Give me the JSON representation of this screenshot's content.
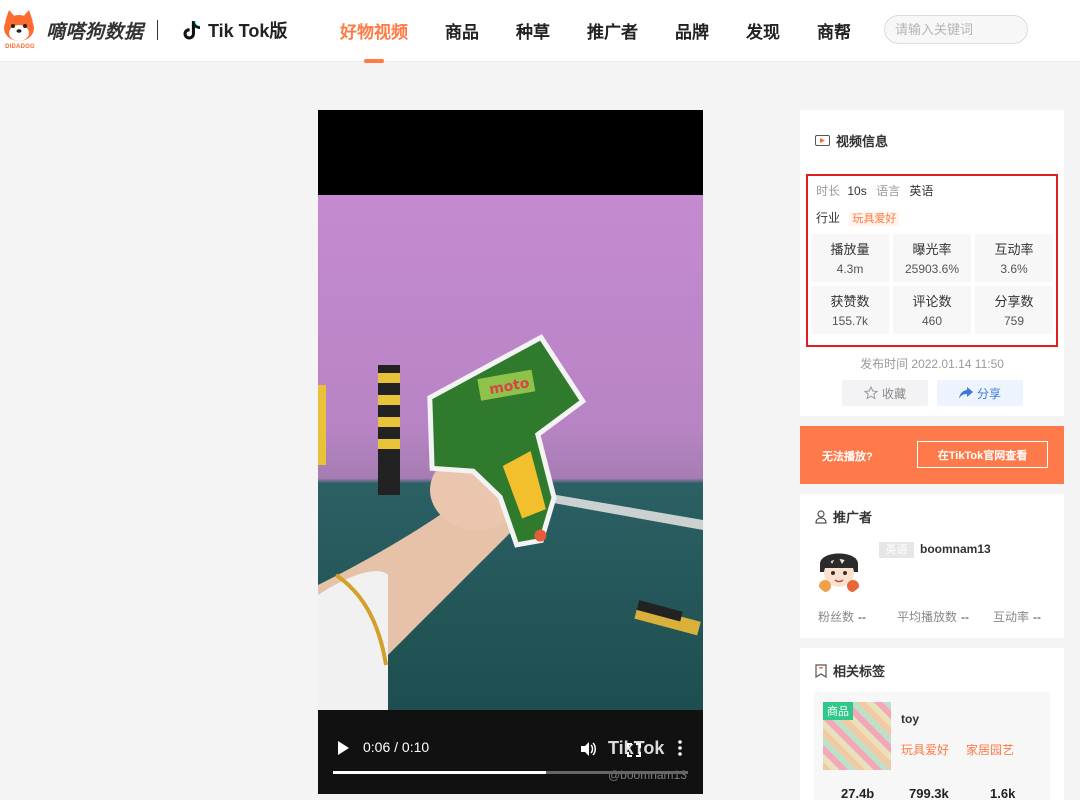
{
  "header": {
    "brand": "嘀嗒狗数据",
    "brand_sub": "DIDADOG",
    "tiktok_label": "Tik Tok版",
    "nav": [
      {
        "label": "好物视频",
        "active": true
      },
      {
        "label": "商品",
        "active": false
      },
      {
        "label": "种草",
        "active": false
      },
      {
        "label": "推广者",
        "active": false
      },
      {
        "label": "品牌",
        "active": false
      },
      {
        "label": "发现",
        "active": false
      },
      {
        "label": "商帮",
        "active": false
      }
    ],
    "search_placeholder": "请输入关键词",
    "accent_color": "#ff7a45"
  },
  "video": {
    "time": "0:06 / 0:10",
    "progress": 0.6,
    "watermark": "TikTok",
    "handle": "@boomnam13",
    "icons": [
      "play-icon",
      "volume-icon",
      "fullscreen-icon",
      "more-icon"
    ]
  },
  "video_info": {
    "title": "视频信息",
    "duration_label": "时长",
    "duration": "10s",
    "language_label": "语言",
    "language": "英语",
    "industry_label": "行业",
    "industry": "玩具爱好",
    "stats": [
      {
        "label": "播放量",
        "value": "4.3m"
      },
      {
        "label": "曝光率",
        "value": "25903.6%"
      },
      {
        "label": "互动率",
        "value": "3.6%"
      },
      {
        "label": "获赞数",
        "value": "155.7k"
      },
      {
        "label": "评论数",
        "value": "460"
      },
      {
        "label": "分享数",
        "value": "759"
      }
    ],
    "publish_time": "发布时间 2022.01.14 11:50",
    "fav_label": "收藏",
    "share_label": "分享"
  },
  "unplayable": {
    "label": "无法播放?",
    "button": "在TikTok官网查看"
  },
  "promoter": {
    "title": "推广者",
    "lang_badge": "英语",
    "name": "boomnam13",
    "stats": [
      {
        "label": "粉丝数",
        "value": "--"
      },
      {
        "label": "平均播放数",
        "value": "--"
      },
      {
        "label": "互动率",
        "value": "--"
      }
    ]
  },
  "tags": {
    "title": "相关标签",
    "item": {
      "badge": "商品",
      "name": "toy",
      "subs": [
        "玩具爱好",
        "家居园艺"
      ],
      "numbers": [
        "27.4b",
        "799.3k",
        "1.6k"
      ]
    }
  }
}
